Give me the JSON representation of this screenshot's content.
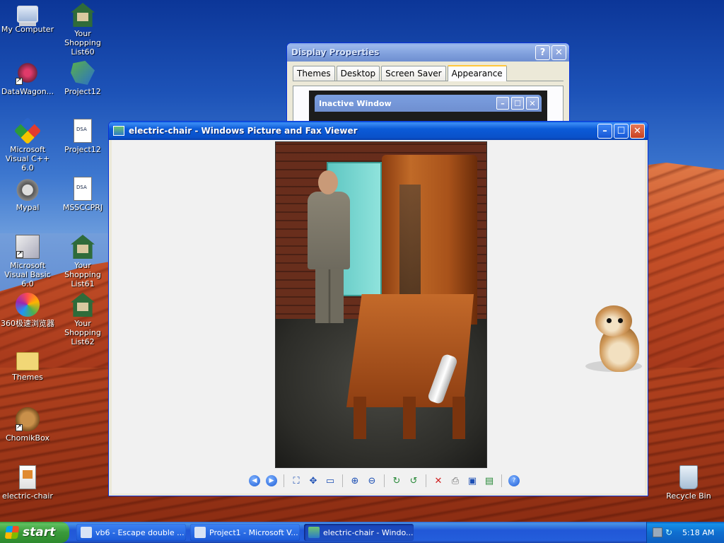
{
  "desktop_icons": [
    {
      "label": "My Computer",
      "icon": "computer-icon"
    },
    {
      "label": "Your Shopping List60",
      "icon": "house-icon"
    },
    {
      "label": "DataWagon...",
      "icon": "swirl-icon"
    },
    {
      "label": "Project12",
      "icon": "network-icon"
    },
    {
      "label": "Microsoft Visual C++ 6.0",
      "icon": "visual-cpp-icon"
    },
    {
      "label": "Project12",
      "icon": "document-icon"
    },
    {
      "label": "Mypal",
      "icon": "raccoon-icon"
    },
    {
      "label": "MSSCCPRJ",
      "icon": "document-icon"
    },
    {
      "label": "Microsoft Visual Basic 6.0",
      "icon": "visual-basic-icon"
    },
    {
      "label": "Your Shopping List61",
      "icon": "house-icon"
    },
    {
      "label": "360极速浏览器",
      "icon": "browser-360-icon"
    },
    {
      "label": "Your Shopping List62",
      "icon": "house-icon"
    },
    {
      "label": "Themes",
      "icon": "folder-icon"
    },
    {
      "label": "ChomikBox",
      "icon": "hamster-icon"
    },
    {
      "label": "electric-chair",
      "icon": "image-file-icon"
    },
    {
      "label": "Recycle Bin",
      "icon": "recycle-bin-icon"
    }
  ],
  "display_properties": {
    "title": "Display Properties",
    "help_label": "?",
    "close_label": "✕",
    "tabs": [
      "Themes",
      "Desktop",
      "Screen Saver",
      "Appearance"
    ],
    "selected_tab": "Appearance",
    "preview": {
      "inactive_title": "Inactive Window"
    }
  },
  "viewer": {
    "title": "electric-chair - Windows Picture and Fax Viewer",
    "min_label": "–",
    "max_label": "☐",
    "close_label": "✕",
    "toolbar": [
      "previous-image",
      "next-image",
      "best-fit",
      "actual-size",
      "slideshow",
      "zoom-in",
      "zoom-out",
      "rotate-clockwise",
      "rotate-counterclockwise",
      "delete",
      "print",
      "save",
      "edit",
      "help"
    ]
  },
  "taskbar": {
    "start_label": "start",
    "items": [
      {
        "label": "vb6 - Escape double ...",
        "active": false
      },
      {
        "label": "Project1 - Microsoft V...",
        "active": false
      },
      {
        "label": "electric-chair - Windo...",
        "active": true
      }
    ],
    "clock": "5:18 AM"
  },
  "colors": {
    "title_active": "#0a5bdc",
    "taskbar": "#245edb",
    "start_green": "#3a9a3a",
    "close_red": "#c9401f"
  }
}
